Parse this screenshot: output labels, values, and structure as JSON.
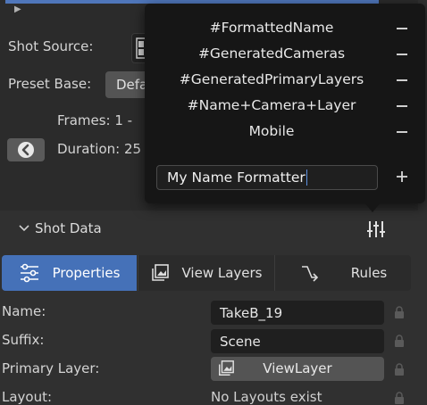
{
  "panel": {
    "shot_source_label": "Shot Source:",
    "preset_base_label": "Preset Base:",
    "preset_base_value": "Defa",
    "frames_text": "Frames: 1  -",
    "duration_text": "Duration: 25"
  },
  "shot_data": {
    "header": "Shot Data"
  },
  "tabs": [
    {
      "label": "Properties",
      "icon": "sliders-icon"
    },
    {
      "label": "View Layers",
      "icon": "image-stack-icon"
    },
    {
      "label": "Rules",
      "icon": "arrow-curve-icon"
    }
  ],
  "properties": {
    "name_label": "Name:",
    "name_value": "TakeB_19",
    "suffix_label": "Suffix:",
    "suffix_value": "Scene",
    "primary_layer_label": "Primary Layer:",
    "primary_layer_value": "ViewLayer",
    "layout_label": "Layout:",
    "layout_value": "No Layouts exist"
  },
  "popup": {
    "items": [
      "#FormattedName",
      "#GeneratedCameras",
      "#GeneratedPrimaryLayers",
      "#Name+Camera+Layer",
      "Mobile"
    ],
    "input_value": "My Name Formatter"
  },
  "colors": {
    "accent": "#4571b8",
    "background": "#303030",
    "popup_bg": "#161616"
  }
}
